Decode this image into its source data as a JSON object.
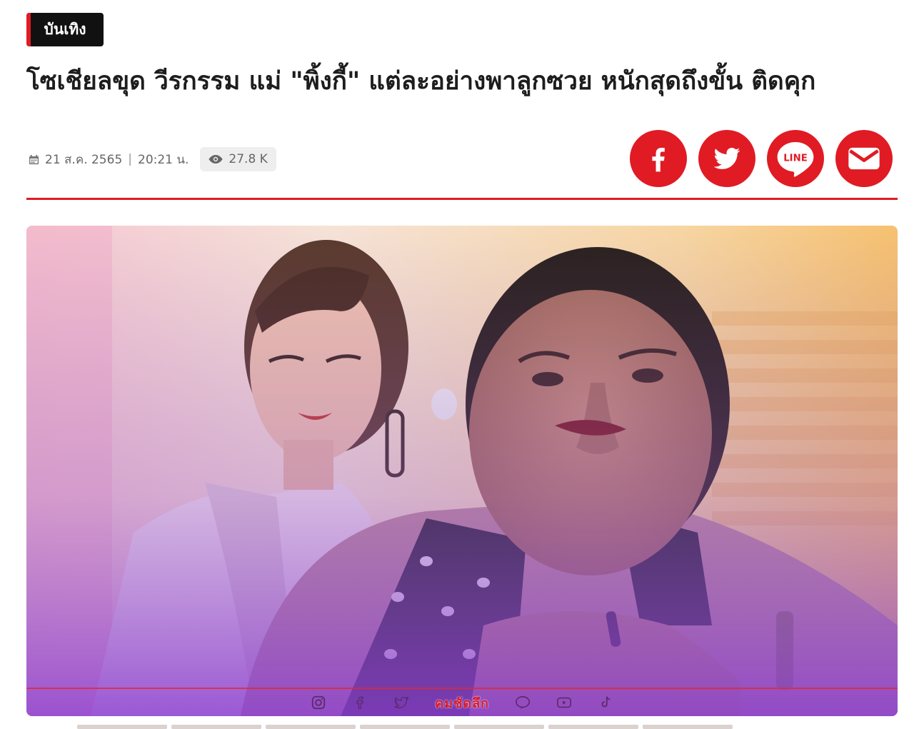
{
  "category": "บันเทิง",
  "headline": "โซเชียลขุด วีรกรรม แม่ \"พิ้งกี้\" แต่ละอย่างพาลูกซวย หนักสุดถึงขั้น ติดคุก",
  "meta": {
    "date": "21 ส.ค. 2565",
    "separator": "|",
    "time": "20:21 น.",
    "views": "27.8 K"
  },
  "share": {
    "line_label": "LINE"
  },
  "hero": {
    "brand_text": "คมชัดลึก"
  },
  "colors": {
    "accent": "#e01b24",
    "tag_bg": "#111111"
  }
}
